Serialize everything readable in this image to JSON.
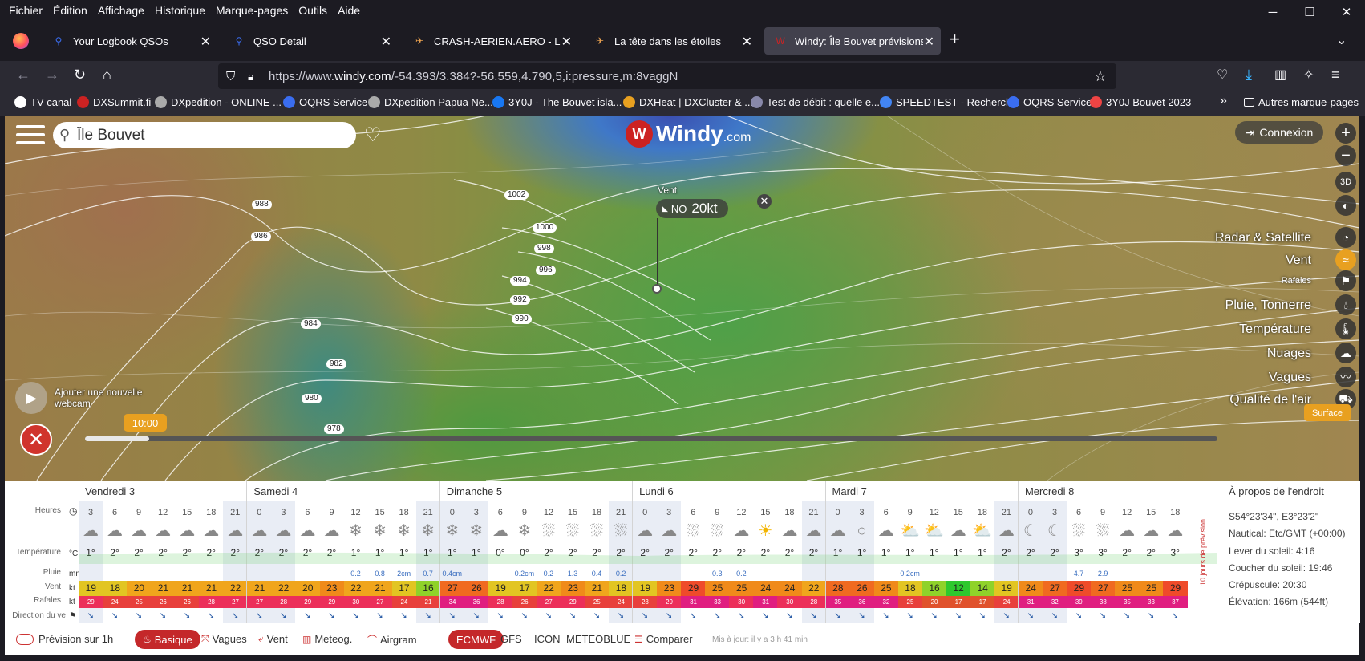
{
  "menu": [
    "Fichier",
    "Édition",
    "Affichage",
    "Historique",
    "Marque-pages",
    "Outils",
    "Aide"
  ],
  "tabs": [
    {
      "title": "Your Logbook QSOs",
      "fav": "⚲",
      "color": "#3a6df0"
    },
    {
      "title": "QSO Detail",
      "fav": "⚲",
      "color": "#3a6df0"
    },
    {
      "title": "CRASH-AERIEN.AERO - Le Site d",
      "fav": "✈",
      "color": "#e8a050"
    },
    {
      "title": "La tête dans les étoiles",
      "fav": "✈",
      "color": "#e8a050"
    },
    {
      "title": "Windy: Île Bouvet prévisions mé",
      "fav": "W",
      "color": "#c22"
    }
  ],
  "url": {
    "prefix": "https://www.",
    "host": "windy.com",
    "path": "/-54.393/3.384?-56.559,4.790,5,i:pressure,m:8vaggN"
  },
  "bookmarks": [
    "TV canal",
    "DXSummit.fi",
    "DXpedition - ONLINE ...",
    "OQRS Service",
    "DXpedition Papua Ne...",
    "3Y0J - The Bouvet isla...",
    "DXHeat | DXCluster & ...",
    "Test de débit : quelle e...",
    "SPEEDTEST - Recherch...",
    "OQRS Service",
    "3Y0J Bouvet 2023"
  ],
  "bookmarks_more": "Autres marque-pages",
  "map": {
    "search_value": "Île Bouvet",
    "logo": "Windy",
    "logo_suffix": ".com",
    "connexion": "Connexion",
    "btn_3d": "3D",
    "layers": [
      "Radar & Satellite",
      "Vent",
      "Rafales",
      "Pluie, Tonnerre",
      "Température",
      "Nuages",
      "Vagues",
      "Qualité de l'air"
    ],
    "pressure_labels": [
      "1002",
      "1000",
      "998",
      "996",
      "994",
      "992",
      "990",
      "988",
      "986",
      "984",
      "982",
      "980",
      "978"
    ],
    "vent_label": "Vent",
    "vent_dir": "NO",
    "vent_speed": "20kt",
    "webcam": "Ajouter une nouvelle webcam",
    "time": "10:00",
    "surface": "Surface"
  },
  "forecast": {
    "days": [
      {
        "name": "Vendredi 3",
        "hours": [
          "3",
          "6",
          "9",
          "12",
          "15",
          "18",
          "21"
        ],
        "temp": [
          "1°",
          "2°",
          "2°",
          "2°",
          "2°",
          "2°",
          "2°"
        ],
        "rain": [
          "",
          "",
          "",
          "",
          "",
          "",
          ""
        ],
        "wind": [
          "19",
          "18",
          "20",
          "21",
          "21",
          "21",
          "22"
        ],
        "gust": [
          "29",
          "24",
          "25",
          "26",
          "26",
          "28",
          "27"
        ],
        "wx": [
          "c",
          "c",
          "c",
          "c",
          "c",
          "c",
          "c"
        ]
      },
      {
        "name": "Samedi 4",
        "hours": [
          "0",
          "3",
          "6",
          "9",
          "12",
          "15",
          "18",
          "21"
        ],
        "temp": [
          "2°",
          "2°",
          "2°",
          "2°",
          "1°",
          "1°",
          "1°",
          "1°"
        ],
        "rain": [
          "",
          "",
          "",
          "",
          "0.2",
          "0.8",
          "2cm",
          "0.7"
        ],
        "wind": [
          "21",
          "22",
          "20",
          "23",
          "22",
          "21",
          "17",
          "16"
        ],
        "gust": [
          "27",
          "28",
          "29",
          "29",
          "30",
          "27",
          "24",
          "21"
        ],
        "wx": [
          "c",
          "c",
          "c",
          "c",
          "s",
          "s",
          "s",
          "s"
        ]
      },
      {
        "name": "Dimanche 5",
        "hours": [
          "0",
          "3",
          "6",
          "9",
          "12",
          "15",
          "18",
          "21"
        ],
        "temp": [
          "1°",
          "1°",
          "0°",
          "0°",
          "2°",
          "2°",
          "2°",
          "2°"
        ],
        "rain": [
          "0.4cm",
          "",
          "",
          "0.2cm",
          "0.2",
          "1.3",
          "0.4",
          "0.2"
        ],
        "wind": [
          "27",
          "26",
          "19",
          "17",
          "22",
          "23",
          "21",
          "18"
        ],
        "gust": [
          "34",
          "36",
          "28",
          "26",
          "27",
          "29",
          "25",
          "24"
        ],
        "wx": [
          "s",
          "s",
          "c",
          "s",
          "r",
          "r",
          "r",
          "r"
        ]
      },
      {
        "name": "Lundi 6",
        "hours": [
          "0",
          "3",
          "6",
          "9",
          "12",
          "15",
          "18",
          "21"
        ],
        "temp": [
          "2°",
          "2°",
          "2°",
          "2°",
          "2°",
          "2°",
          "2°",
          "2°"
        ],
        "rain": [
          "",
          "",
          "",
          "0.3",
          "0.2",
          "",
          "",
          ""
        ],
        "wind": [
          "19",
          "23",
          "29",
          "25",
          "25",
          "24",
          "24",
          "22"
        ],
        "gust": [
          "23",
          "29",
          "31",
          "33",
          "30",
          "31",
          "30",
          "28"
        ],
        "wx": [
          "c",
          "c",
          "r",
          "r",
          "c",
          "sun",
          "c",
          "c"
        ]
      },
      {
        "name": "Mardi 7",
        "hours": [
          "0",
          "3",
          "6",
          "9",
          "12",
          "15",
          "18",
          "21"
        ],
        "temp": [
          "1°",
          "1°",
          "1°",
          "1°",
          "1°",
          "1°",
          "1°",
          "2°"
        ],
        "rain": [
          "",
          "",
          "",
          "0.2cm",
          "",
          "",
          "",
          ""
        ],
        "wind": [
          "28",
          "26",
          "25",
          "18",
          "16",
          "12",
          "14",
          "19"
        ],
        "gust": [
          "35",
          "36",
          "32",
          "25",
          "20",
          "17",
          "17",
          "24"
        ],
        "wx": [
          "c",
          "o",
          "c",
          "ps",
          "ps",
          "c",
          "ps",
          "c"
        ]
      },
      {
        "name": "Mercredi 8",
        "hours": [
          "0",
          "3",
          "6",
          "9",
          "12",
          "15",
          "18"
        ],
        "temp": [
          "2°",
          "2°",
          "3°",
          "3°",
          "2°",
          "2°",
          "3°"
        ],
        "rain": [
          "",
          "",
          "4.7",
          "2.9",
          "",
          "",
          ""
        ],
        "wind": [
          "24",
          "27",
          "29",
          "27",
          "25",
          "25",
          "29"
        ],
        "gust": [
          "31",
          "32",
          "39",
          "38",
          "35",
          "33",
          "37"
        ],
        "wx": [
          "n",
          "n",
          "r",
          "r",
          "c",
          "c",
          "c"
        ]
      }
    ],
    "labels": {
      "hours": "Heures",
      "temp": "Température",
      "temp_unit": "°C",
      "rain": "Pluie",
      "rain_unit": "mm",
      "wind": "Vent",
      "wind_unit": "kt",
      "gust": "Rafales",
      "gust_unit": "kt",
      "dir": "Direction du ve"
    },
    "tenday": "10 jours de prévision",
    "about": {
      "title": "À propos de l'endroit",
      "coords": "S54°23'34\", E3°23'2\"",
      "tz": "Nautical: Etc/GMT (+00:00)",
      "sunrise": "Lever du soleil: 4:16",
      "sunset": "Coucher du soleil: 19:46",
      "dusk": "Crépuscule: 20:30",
      "elev": "Élévation: 166m (544ft)"
    }
  },
  "toolbar": {
    "prev1h": "Prévision sur 1h",
    "basique": "Basique",
    "vagues": "Vagues",
    "vent": "Vent",
    "meteog": "Meteog.",
    "airgram": "Airgram",
    "ecmwf": "ECMWF",
    "gfs": "GFS",
    "icon": "ICON",
    "meteoblue": "METEOBLUE",
    "comparer": "Comparer",
    "updated": "Mis à jour: il y a 3 h 41 min"
  }
}
